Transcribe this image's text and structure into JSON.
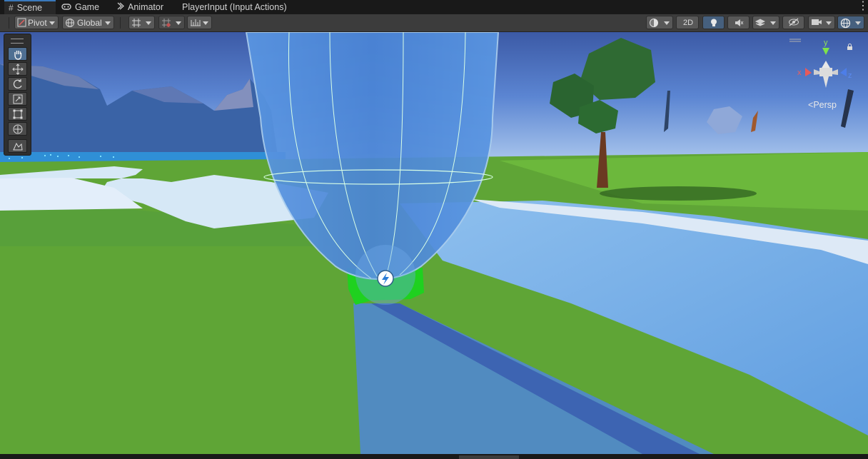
{
  "window": {
    "tabs": [
      {
        "label": "Scene",
        "icon": "hash-icon",
        "active": true
      },
      {
        "label": "Game",
        "icon": "gamepad-icon",
        "active": false
      },
      {
        "label": "Animator",
        "icon": "animator-icon",
        "active": false
      },
      {
        "label": "PlayerInput (Input Actions)",
        "icon": "",
        "active": false
      }
    ]
  },
  "toolbar": {
    "pivot_label": "Pivot",
    "space_label": "Global",
    "mode_2d_label": "2D"
  },
  "scene": {
    "projection_label": "Persp",
    "gizmo_axis_y": "y",
    "gizmo_axis_x": "x",
    "gizmo_axis_z": "z"
  },
  "tools": [
    "hand-tool",
    "move-tool",
    "rotate-tool",
    "scale-tool",
    "rect-tool",
    "transform-tool",
    "custom-tool"
  ],
  "colors": {
    "accent": "#3a79bb",
    "sky_top": "#3d5ea8",
    "grass": "#5fa536",
    "water": "#6eaae0",
    "capsule": "#4f8fdc",
    "ground_ring": "#22d22a"
  }
}
